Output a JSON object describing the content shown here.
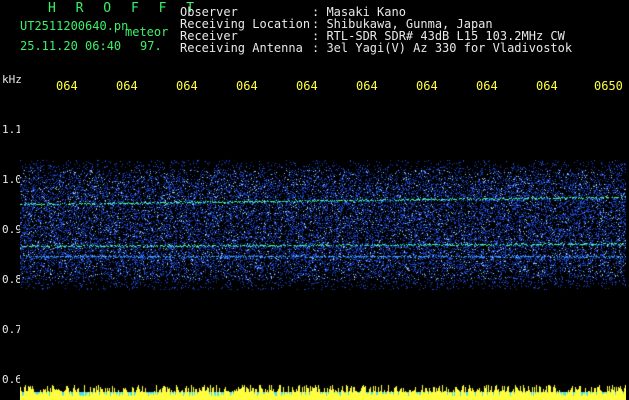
{
  "header": {
    "title": "H R O F F T",
    "filename": "UT2511200640.pn",
    "mode": "meteor",
    "datetime": "25.11.20 06:40",
    "count": "97."
  },
  "info": [
    {
      "label": "Observer",
      "value": ": Masaki Kano"
    },
    {
      "label": "Receiving Location",
      "value": ": Shibukawa, Gunma, Japan"
    },
    {
      "label": "Receiver",
      "value": ": RTL-SDR SDR# 43dB L15 103.2MHz CW"
    },
    {
      "label": "Receiving Antenna",
      "value": ": 3el Yagi(V) Az 330 for Vladivostok"
    }
  ],
  "y_axis": {
    "unit": "kHz",
    "ticks": [
      "1.1",
      "1.0",
      "0.9",
      "0.8",
      "0.7",
      "0.6"
    ]
  },
  "time_ticks": [
    "064",
    "064",
    "064",
    "064",
    "064",
    "064",
    "064",
    "064",
    "064",
    "0650"
  ],
  "colors": {
    "background": "#000000",
    "noise_blue": "#1a3cff",
    "signal_green": "#40ff90",
    "signal_yellow": "#ffff40",
    "signal_cyan": "#40e0ff"
  }
}
